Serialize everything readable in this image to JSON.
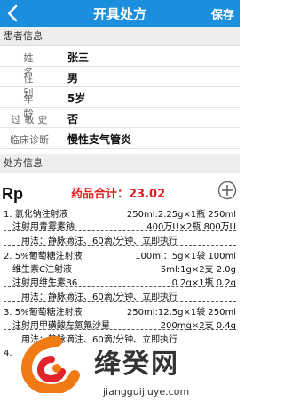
{
  "header": {
    "title": "开具处方",
    "save_label": "保存"
  },
  "patient_section": {
    "title": "患者信息"
  },
  "patient": [
    {
      "label": "姓名",
      "value": "张三"
    },
    {
      "label": "性别",
      "value": "男"
    },
    {
      "label": "年龄",
      "value": "5岁"
    },
    {
      "label": "过敏史",
      "value": "否"
    },
    {
      "label": "临床诊断",
      "value": "慢性支气管炎"
    }
  ],
  "rx_section": {
    "title": "处方信息"
  },
  "rx": {
    "rp_label": "Rp",
    "total_label": "药品合计：23.02",
    "items": [
      {
        "left": "1. 氯化钠注射液",
        "right": "250ml:2.25g×1瓶 250ml"
      },
      {
        "left": "注射用青霉素钠",
        "right": "400万U×2瓶 800万U"
      },
      {
        "usage": "用法：静脉滴注、60滴/分钟、立即执行"
      },
      {
        "left": "2. 5%葡萄糖注射液",
        "right": "100ml：5g×1袋 100ml"
      },
      {
        "left": "维生素C注射液",
        "right": "5ml:1g×2支 2.0g"
      },
      {
        "left": "注射用维生素B6",
        "right": "0.2g×1瓶 0.2g"
      },
      {
        "usage": "用法：静脉滴注、60滴/分钟、立即执行"
      },
      {
        "left": "3. 5%葡萄糖注射液",
        "right": "250ml:12.5g×1袋 250ml"
      },
      {
        "left": "注射用甲磺酸左氧氟沙星",
        "right": "200mg×2支 0.4g"
      },
      {
        "usage": "用法：静脉滴注、60滴/分钟、立即执行"
      },
      {
        "left": "4.",
        "right": ""
      }
    ]
  },
  "watermark": {
    "brand": "绛癸网",
    "domain": "jiangguijiuye.com"
  },
  "colors": {
    "primary": "#1b8ede",
    "total": "#e02020"
  }
}
